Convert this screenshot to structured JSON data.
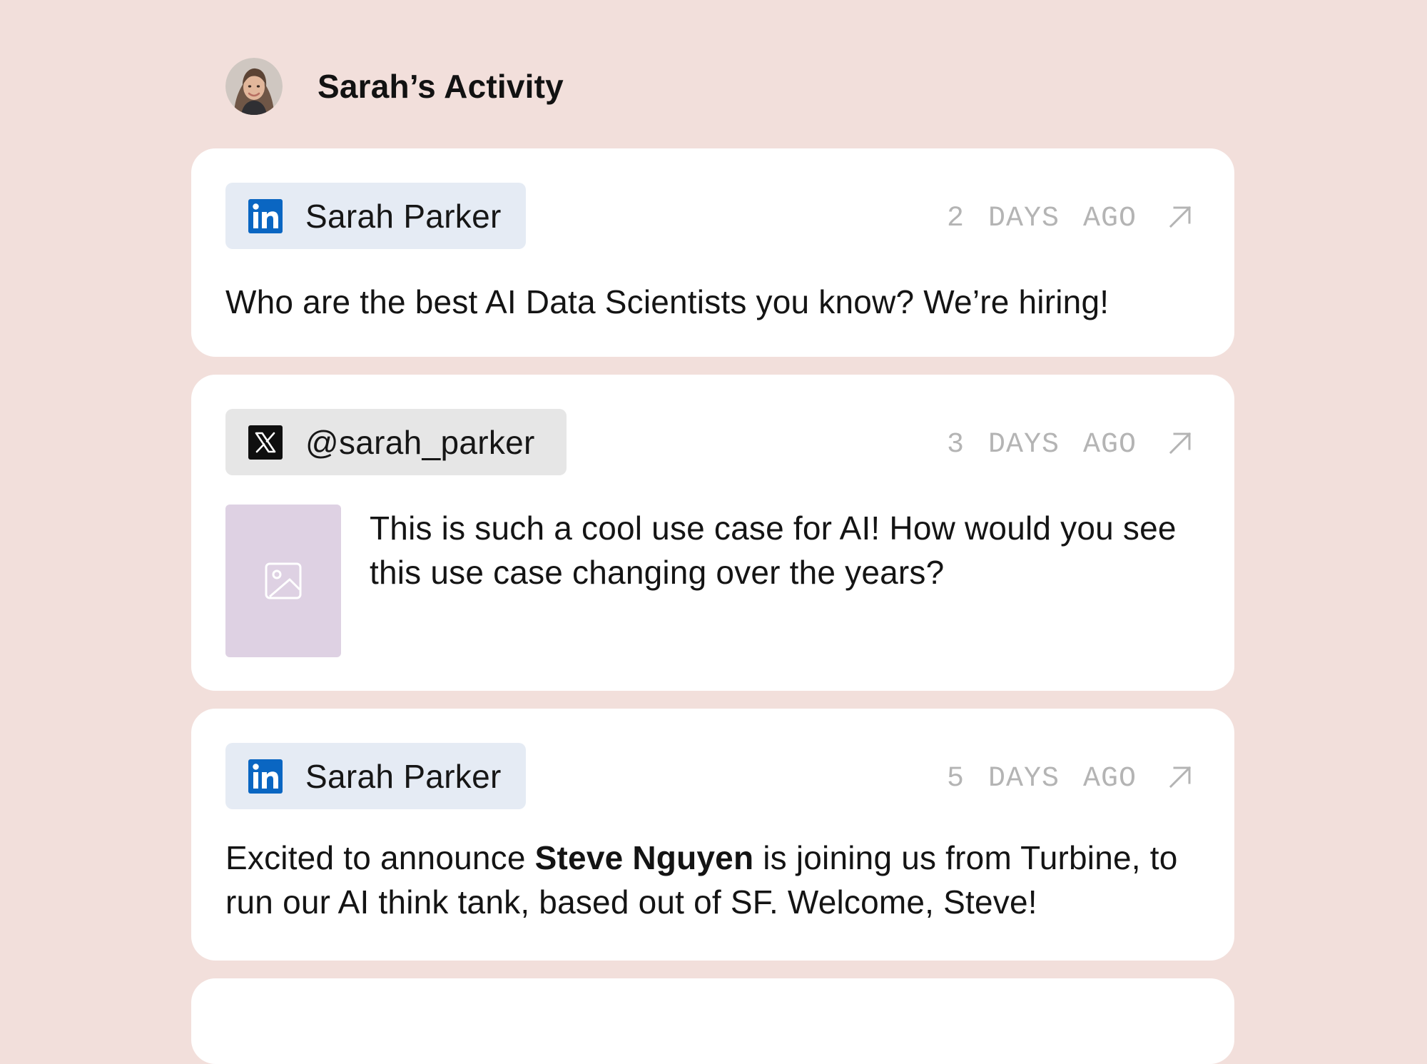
{
  "header": {
    "title": "Sarah’s Activity",
    "avatar_icon": "user-avatar"
  },
  "posts": [
    {
      "platform": "linkedin",
      "platform_icon": "linkedin-icon",
      "author": "Sarah Parker",
      "timestamp": "2 DAYS AGO",
      "text": "Who are the best AI Data Scientists you know? We’re hiring!"
    },
    {
      "platform": "x",
      "platform_icon": "x-icon",
      "author": "@sarah_parker",
      "timestamp": "3 DAYS AGO",
      "has_image": true,
      "image_icon": "image-placeholder-icon",
      "text": "This is such a cool use case for AI! How would you see this use case changing over the years?"
    },
    {
      "platform": "linkedin",
      "platform_icon": "linkedin-icon",
      "author": "Sarah Parker",
      "timestamp": "5 DAYS AGO",
      "text_before": "Excited to announce ",
      "text_bold": "Steve Nguyen",
      "text_after": " is joining us from Turbine, to run our AI think tank, based out of SF. Welcome, Steve!"
    }
  ],
  "colors": {
    "background": "#f2dfdb",
    "card": "#ffffff",
    "linkedin_blue": "#0a66c2",
    "linkedin_chip": "#e5ebf4",
    "x_chip": "#e6e6e6",
    "thumbnail": "#ded1e3",
    "timestamp": "#b4b4b4"
  }
}
